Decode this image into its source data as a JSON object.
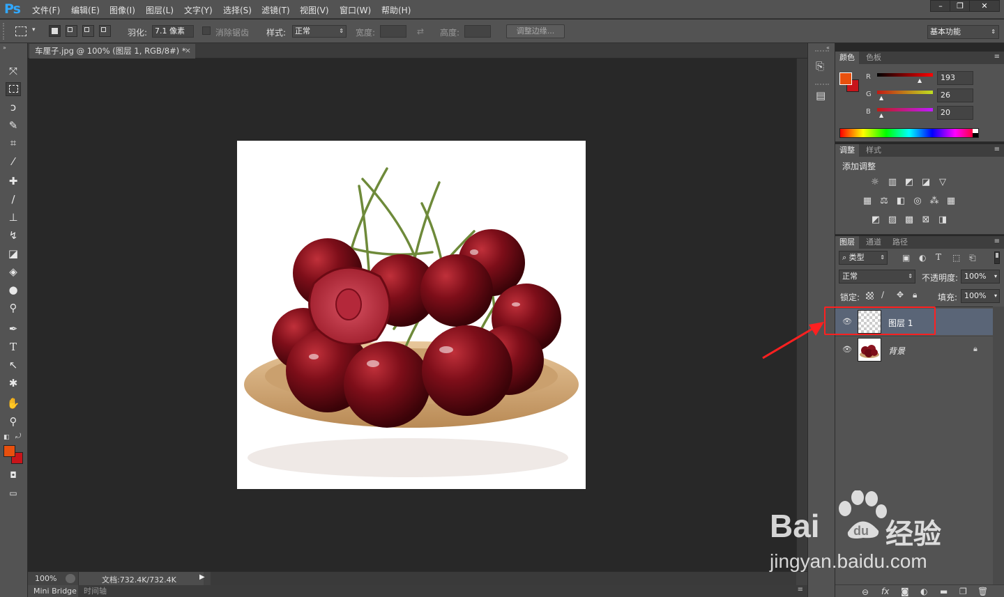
{
  "app": {
    "logo": "Ps"
  },
  "menu": [
    "文件(F)",
    "编辑(E)",
    "图像(I)",
    "图层(L)",
    "文字(Y)",
    "选择(S)",
    "滤镜(T)",
    "视图(V)",
    "窗口(W)",
    "帮助(H)"
  ],
  "window_controls": {
    "minimize": "–",
    "restore": "❐",
    "close": "✕"
  },
  "options": {
    "feather_label": "羽化:",
    "feather_value": "7.1 像素",
    "antialias_label": "消除锯齿",
    "style_label": "样式:",
    "style_value": "正常",
    "width_label": "宽度:",
    "height_label": "高度:",
    "refine_edge_label": "调整边缘...",
    "workspace_value": "基本功能"
  },
  "document": {
    "tab_title": "车厘子.jpg @ 100% (图层 1, RGB/8#) *",
    "close": "×"
  },
  "status": {
    "zoom": "100%",
    "doc_info": "文档:732.4K/732.4K"
  },
  "bottom_tabs": [
    "Mini Bridge",
    "时间轴"
  ],
  "color_panel": {
    "tabs": [
      "颜色",
      "色板"
    ],
    "channels": [
      {
        "label": "R",
        "value": "193"
      },
      {
        "label": "G",
        "value": "26"
      },
      {
        "label": "B",
        "value": "20"
      }
    ],
    "foreground": "#c11a14",
    "fg_display": "#e8500e",
    "bg_display": "#c8141a"
  },
  "adjustments_panel": {
    "tabs": [
      "调整",
      "样式"
    ],
    "add_label": "添加调整"
  },
  "layers_panel": {
    "tabs": [
      "图层",
      "通道",
      "路径"
    ],
    "filter_kind": "类型",
    "blend_mode": "正常",
    "opacity_label": "不透明度:",
    "opacity_value": "100%",
    "lock_label": "锁定:",
    "fill_label": "填充:",
    "fill_value": "100%",
    "layers": [
      {
        "name": "图层 1",
        "selected": true
      },
      {
        "name": "背景",
        "selected": false,
        "locked": true
      }
    ]
  },
  "watermark": {
    "brand": "Bai",
    "brand2": "经验",
    "url": "jingyan.baidu.com"
  },
  "annotation": {
    "color": "#ff2020"
  }
}
